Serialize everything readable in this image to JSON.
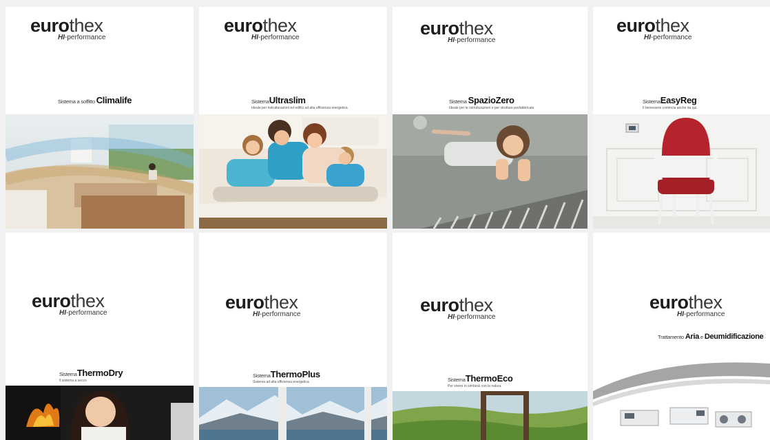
{
  "brand": {
    "bold": "euro",
    "light": "thex",
    "sub_bold": "HI",
    "sub_rest": "-performance"
  },
  "cards": [
    {
      "prefix": "Sistema a soffitto ",
      "name": "Climalife",
      "tagline": ""
    },
    {
      "prefix": "Sistema",
      "name": "Ultraslim",
      "tagline": "Ideale per ristrutturazioni ed edifici ad alta efficienza energetica"
    },
    {
      "prefix": "Sistema ",
      "name": "SpazioZero",
      "tagline": "Ideale per le ristrutturazioni e per strutture prefabbricate"
    },
    {
      "prefix": "Sistema",
      "name": "EasyReg",
      "tagline": "Il benessere comincia anche da qui."
    },
    {
      "prefix": "Sistema",
      "name": "ThermoDry",
      "tagline": "Il sistema a secco"
    },
    {
      "prefix": "Sistema",
      "name": "ThermoPlus",
      "tagline": "Sistema ad alta efficienza energetica"
    },
    {
      "prefix": "Sistema",
      "name": "ThermoEco",
      "tagline": "Per vivere in simbiosi con la natura"
    },
    {
      "prefix": "Trattamento ",
      "name": "Aria",
      "mid": " e ",
      "name2": "Deumidificazione",
      "tagline": ""
    }
  ]
}
